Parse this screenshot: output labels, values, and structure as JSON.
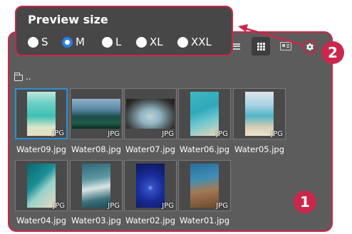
{
  "popover": {
    "title": "Preview size",
    "options": [
      {
        "label": "S",
        "selected": false
      },
      {
        "label": "M",
        "selected": true
      },
      {
        "label": "L",
        "selected": false
      },
      {
        "label": "XL",
        "selected": false
      },
      {
        "label": "XXL",
        "selected": false
      }
    ]
  },
  "toolbar": {
    "views": [
      {
        "icon": "list-view-icon",
        "active": false
      },
      {
        "icon": "grid-view-icon",
        "active": true
      },
      {
        "icon": "card-view-icon",
        "active": false
      }
    ],
    "settings_icon": "gear-icon"
  },
  "folder": {
    "label": ".."
  },
  "files": [
    {
      "name": "Water09.jpg",
      "ext": "JPG",
      "selected": true
    },
    {
      "name": "Water08.jpg",
      "ext": "JPG",
      "selected": false
    },
    {
      "name": "Water07.jpg",
      "ext": "JPG",
      "selected": false
    },
    {
      "name": "Water06.jpg",
      "ext": "JPG",
      "selected": false
    },
    {
      "name": "Water05.jpg",
      "ext": "JPG",
      "selected": false
    },
    {
      "name": "Water04.jpg",
      "ext": "JPG",
      "selected": false
    },
    {
      "name": "Water03.jpg",
      "ext": "JPG",
      "selected": false
    },
    {
      "name": "Water02.jpg",
      "ext": "JPG",
      "selected": false
    },
    {
      "name": "Water01.jpg",
      "ext": "JPG",
      "selected": false
    }
  ],
  "callouts": {
    "one": "1",
    "two": "2"
  },
  "colors": {
    "accent": "#c9274b",
    "selection": "#2e8fd6",
    "radio_checked": "#2b7de9",
    "panel": "#5c5c5c"
  }
}
